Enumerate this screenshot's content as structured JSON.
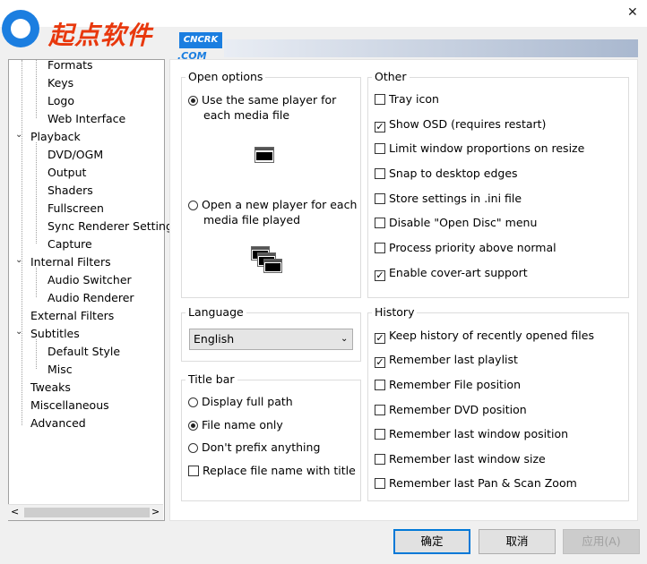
{
  "watermark": {
    "brand": "起点软件",
    "badge": "CNCRK",
    "domain": ".COM",
    "icon": "logo-circle-icon"
  },
  "window": {
    "close_glyph": "✕"
  },
  "tree": {
    "items": [
      {
        "label": "Formats"
      },
      {
        "label": "Keys"
      },
      {
        "label": "Logo"
      },
      {
        "label": "Web Interface"
      },
      {
        "label": "Playback"
      },
      {
        "label": "DVD/OGM"
      },
      {
        "label": "Output"
      },
      {
        "label": "Shaders"
      },
      {
        "label": "Fullscreen"
      },
      {
        "label": "Sync Renderer Setting"
      },
      {
        "label": "Capture"
      },
      {
        "label": "Internal Filters"
      },
      {
        "label": "Audio Switcher"
      },
      {
        "label": "Audio Renderer"
      },
      {
        "label": "External Filters"
      },
      {
        "label": "Subtitles"
      },
      {
        "label": "Default Style"
      },
      {
        "label": "Misc"
      },
      {
        "label": "Tweaks"
      },
      {
        "label": "Miscellaneous"
      },
      {
        "label": "Advanced"
      }
    ],
    "expand_glyph": "⌄",
    "scroll_left": "<",
    "scroll_right": ">"
  },
  "open_options": {
    "title": "Open options",
    "same_player_line1": "Use the same player for",
    "same_player_line2": "each media file",
    "new_player_line1": "Open a new player for each",
    "new_player_line2": "media file played",
    "selected": "same"
  },
  "other": {
    "title": "Other",
    "items": [
      {
        "label": "Tray icon",
        "checked": false
      },
      {
        "label": "Show OSD (requires restart)",
        "checked": true
      },
      {
        "label": "Limit window proportions on resize",
        "checked": false
      },
      {
        "label": "Snap to desktop edges",
        "checked": false
      },
      {
        "label": "Store settings in .ini file",
        "checked": false
      },
      {
        "label": "Disable \"Open Disc\" menu",
        "checked": false
      },
      {
        "label": "Process priority above normal",
        "checked": false
      },
      {
        "label": "Enable cover-art support",
        "checked": true
      }
    ]
  },
  "language": {
    "title": "Language",
    "value": "English"
  },
  "title_bar": {
    "title": "Title bar",
    "display_full_path": "Display full path",
    "file_name_only": "File name only",
    "dont_prefix": "Don't prefix anything",
    "replace_with_title": "Replace file name with title",
    "selected": "file_name_only"
  },
  "history": {
    "title": "History",
    "items": [
      {
        "label": "Keep history of recently opened files",
        "checked": true
      },
      {
        "label": "Remember last playlist",
        "checked": true
      },
      {
        "label": "Remember File position",
        "checked": false
      },
      {
        "label": "Remember DVD position",
        "checked": false
      },
      {
        "label": "Remember last window position",
        "checked": false
      },
      {
        "label": "Remember last window size",
        "checked": false
      },
      {
        "label": "Remember last Pan & Scan Zoom",
        "checked": false
      }
    ]
  },
  "buttons": {
    "ok": "确定",
    "cancel": "取消",
    "apply": "应用(A)"
  }
}
